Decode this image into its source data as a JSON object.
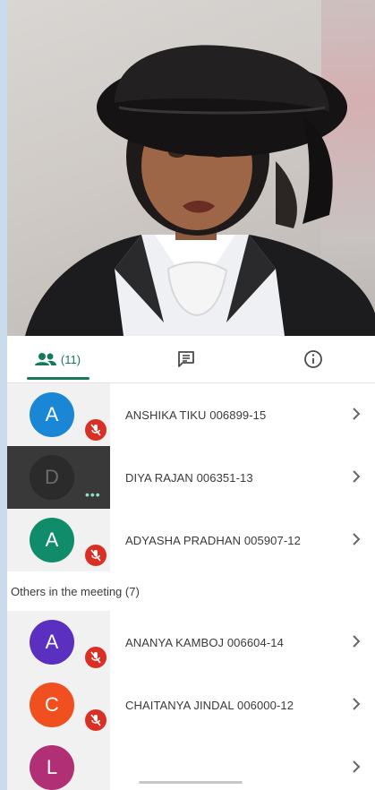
{
  "tabs": {
    "people_count": "(11)"
  },
  "participants": [
    {
      "initial": "A",
      "name": "ANSHIKA TIKU 006899-15",
      "color": "#1a86d6",
      "muted": true
    },
    {
      "initial": "D",
      "name": "DIYA RAJAN 006351-13",
      "color": "#2b2b2b",
      "muted": false
    },
    {
      "initial": "A",
      "name": "ADYASHA PRADHAN 005907-12",
      "color": "#118c6a",
      "muted": true
    }
  ],
  "others_label": "Others in the meeting (7)",
  "others": [
    {
      "initial": "A",
      "name": "ANANYA KAMBOJ 006604-14",
      "color": "#5b2fbf",
      "muted": true
    },
    {
      "initial": "C",
      "name": "CHAITANYA JINDAL 006000-12",
      "color": "#f0501f",
      "muted": true
    },
    {
      "initial": "L",
      "name": "",
      "color": "#b12f75",
      "muted": true
    }
  ],
  "icons": {
    "people": "people-icon",
    "chat": "chat-icon",
    "info": "info-icon",
    "mic_off": "mic-off-icon",
    "chevron": "chevron-right-icon"
  }
}
